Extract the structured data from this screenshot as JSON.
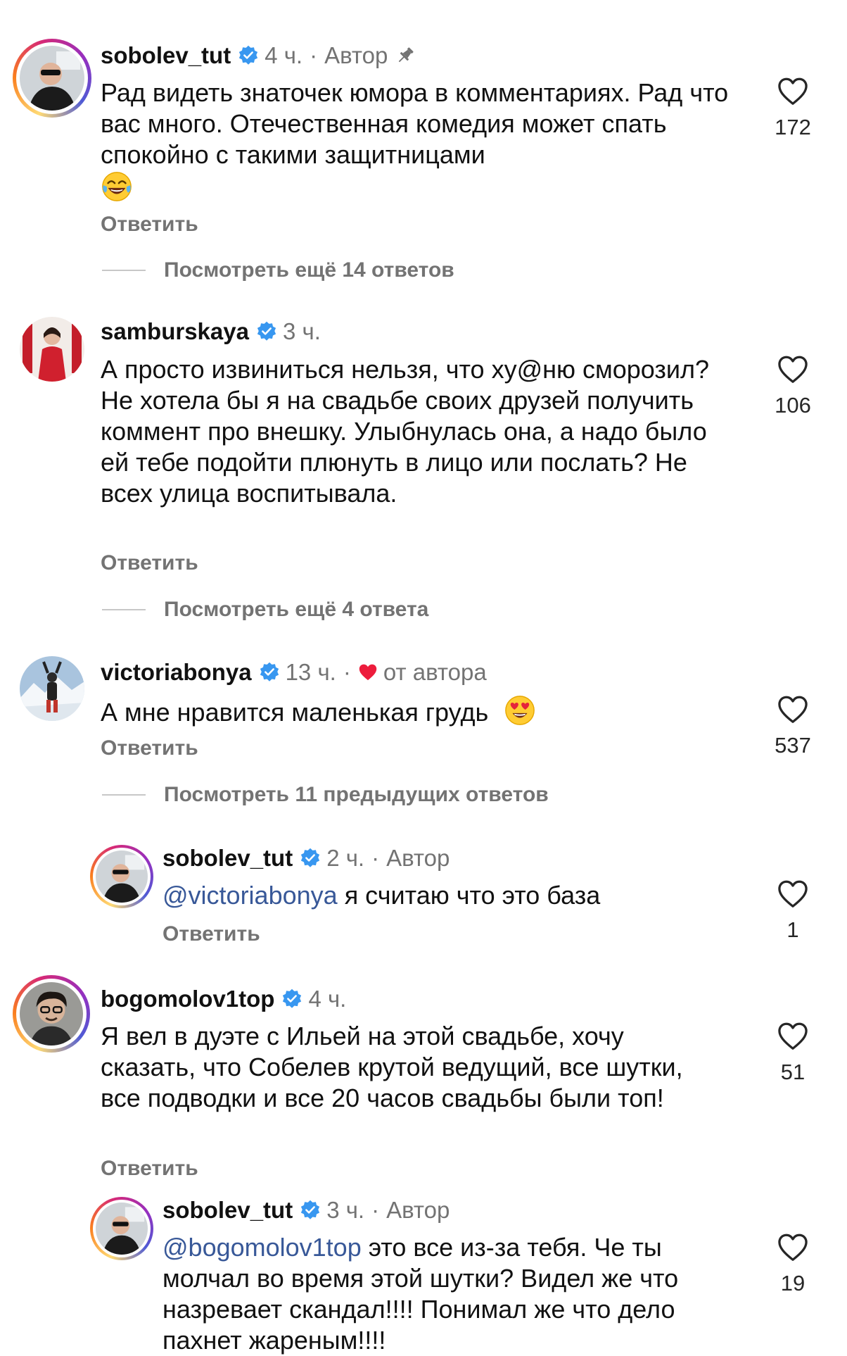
{
  "reply_label": "Ответить",
  "comments": [
    {
      "username": "sobolev_tut",
      "time": "4 ч.",
      "author_tag": "Автор",
      "pinned": true,
      "text": "Рад видеть знаточек юмора в комментариях. Рад что вас много. Отечественная комедия может спать спокойно с такими защитницами",
      "emoji": "face-with-tears-of-joy",
      "likes": "172",
      "view_more": "Посмотреть ещё 14 ответов"
    },
    {
      "username": "samburskaya",
      "time": "3 ч.",
      "text": "А просто извиниться нельзя, что ху@ню сморозил? Не хотела бы я на свадьбе своих друзей получить коммент про внешку. Улыбнулась она, а надо было ей тебе подойти плюнуть в лицо или послать? Не всех улица воспитывала.",
      "likes": "106",
      "view_more": "Посмотреть ещё 4 ответа"
    },
    {
      "username": "victoriabonya",
      "time": "13 ч.",
      "liked_by_author": "от автора",
      "text": "А мне нравится маленькая грудь",
      "emoji": "smiling-face-with-heart-eyes",
      "likes": "537",
      "view_more": "Посмотреть 11 предыдущих ответов"
    },
    {
      "username": "sobolev_tut",
      "time": "2 ч.",
      "author_tag": "Автор",
      "mention": "@victoriabonya",
      "text": "я считаю что это база",
      "likes": "1"
    },
    {
      "username": "bogomolov1top",
      "time": "4 ч.",
      "text": "Я вел в дуэте с Ильей на этой свадьбе, хочу сказать, что Собелев крутой ведущий, все шутки, все подводки и все 20 часов свадьбы были топ!",
      "likes": "51"
    },
    {
      "username": "sobolev_tut",
      "time": "3 ч.",
      "author_tag": "Автор",
      "mention": "@bogomolov1top",
      "text": "это все из-за тебя. Че ты молчал во время этой шутки? Видел же что назревает скандал!!!! Понимал же что дело пахнет жареным!!!!",
      "likes": "19"
    }
  ],
  "colors": {
    "mention": "#385898",
    "verified": "#3897f0",
    "secondary_text": "#737373",
    "heart_red": "#ed1c3c"
  }
}
